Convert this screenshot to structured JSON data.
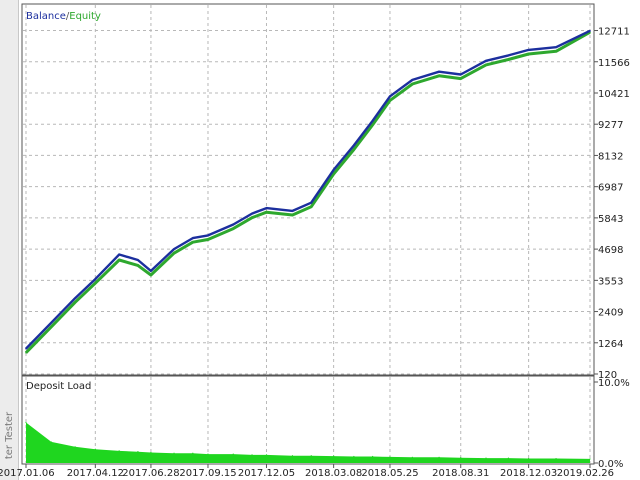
{
  "sidebar": {
    "label": "ter Tester"
  },
  "chart_data": [
    {
      "type": "line",
      "title": "",
      "legend": [
        {
          "name": "Balance",
          "color": "#1c2f9e"
        },
        {
          "name": "Equity",
          "color": "#2ea82e"
        }
      ],
      "legend_separator": " / ",
      "legend_placement": "top-left",
      "grid": true,
      "ylim": [
        120,
        12950
      ],
      "y_tick_labels": [
        "12711",
        "11566",
        "10421",
        "9277",
        "8132",
        "6987",
        "5843",
        "4698",
        "3553",
        "2409",
        "1264",
        "120"
      ],
      "y_ticks": [
        12711,
        11566,
        10421,
        9277,
        8132,
        6987,
        5843,
        4698,
        3553,
        2409,
        1264,
        120
      ],
      "x_tick_labels": [
        "2017.01.06",
        "2017.04.12",
        "2017.06.28",
        "2017.09.15",
        "2017.12.05",
        "2018.03.08",
        "2018.05.25",
        "2018.08.31",
        "2018.12.03",
        "2019.02.26"
      ],
      "x": [
        "2017.01.06",
        "2017.02.10",
        "2017.03.15",
        "2017.04.12",
        "2017.05.15",
        "2017.06.10",
        "2017.06.28",
        "2017.07.30",
        "2017.08.25",
        "2017.09.15",
        "2017.10.20",
        "2017.11.15",
        "2017.12.05",
        "2018.01.10",
        "2018.02.05",
        "2018.03.08",
        "2018.04.05",
        "2018.05.01",
        "2018.05.25",
        "2018.06.25",
        "2018.08.01",
        "2018.08.31",
        "2018.10.05",
        "2018.11.05",
        "2018.12.03",
        "2019.01.10",
        "2019.02.26"
      ],
      "series": [
        {
          "name": "Balance",
          "color": "#1c2f9e",
          "values": [
            1050,
            2000,
            2900,
            3600,
            4500,
            4300,
            3900,
            4700,
            5100,
            5200,
            5600,
            6000,
            6200,
            6100,
            6400,
            7600,
            8500,
            9400,
            10300,
            10900,
            11200,
            11100,
            11600,
            11800,
            12000,
            12100,
            12700
          ]
        },
        {
          "name": "Equity",
          "color": "#2ea82e",
          "values": [
            900,
            1850,
            2750,
            3450,
            4300,
            4100,
            3750,
            4550,
            4950,
            5050,
            5450,
            5850,
            6050,
            5950,
            6250,
            7450,
            8350,
            9250,
            10150,
            10750,
            11050,
            10950,
            11450,
            11650,
            11850,
            11950,
            12650
          ]
        }
      ]
    },
    {
      "type": "area",
      "title": "Deposit Load",
      "color": "#1fd61f",
      "ylim": [
        0,
        10
      ],
      "y_tick_labels": [
        "10.0%",
        "0.0%"
      ],
      "y_ticks": [
        10,
        0
      ],
      "x": [
        "2017.01.06",
        "2017.02.10",
        "2017.03.15",
        "2017.04.12",
        "2017.05.15",
        "2017.06.10",
        "2017.06.28",
        "2017.07.30",
        "2017.08.25",
        "2017.09.15",
        "2017.10.20",
        "2017.11.15",
        "2017.12.05",
        "2018.01.10",
        "2018.02.05",
        "2018.03.08",
        "2018.04.05",
        "2018.05.01",
        "2018.05.25",
        "2018.06.25",
        "2018.08.01",
        "2018.08.31",
        "2018.10.05",
        "2018.11.05",
        "2018.12.03",
        "2019.01.10",
        "2019.02.26"
      ],
      "values": [
        5.0,
        2.6,
        2.0,
        1.7,
        1.5,
        1.4,
        1.3,
        1.2,
        1.2,
        1.1,
        1.1,
        1.0,
        1.0,
        0.9,
        0.9,
        0.85,
        0.8,
        0.8,
        0.75,
        0.7,
        0.7,
        0.65,
        0.6,
        0.6,
        0.55,
        0.55,
        0.5
      ]
    }
  ]
}
